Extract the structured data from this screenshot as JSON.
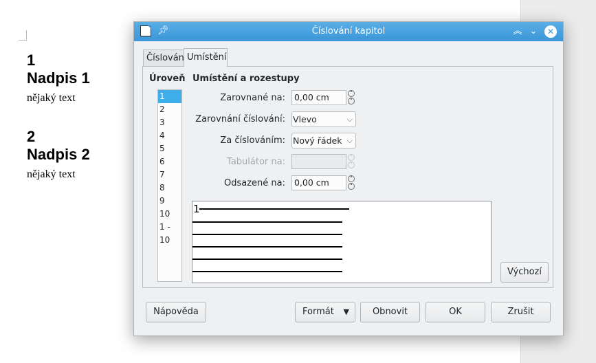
{
  "document": {
    "sections": [
      {
        "number": "1",
        "heading": "Nadpis 1",
        "text": "nějaký text"
      },
      {
        "number": "2",
        "heading": "Nadpis 2",
        "text": "nějaký text"
      }
    ]
  },
  "dialog": {
    "title": "Číslování kapitol",
    "window_buttons": {
      "shade": "︽",
      "minimize": "⌄",
      "close": "✕"
    },
    "tabs": [
      {
        "label": "Číslování",
        "active": false
      },
      {
        "label": "Umístění",
        "active": true
      }
    ],
    "level": {
      "heading": "Úroveň",
      "items": [
        "1",
        "2",
        "3",
        "4",
        "5",
        "6",
        "7",
        "8",
        "9",
        "10",
        "1 - 10"
      ],
      "selected": "1"
    },
    "position": {
      "heading": "Umístění a rozestupy",
      "aligned_at": {
        "label": "Zarovnané na:",
        "value": "0,00 cm"
      },
      "numbering_alignment": {
        "label": "Zarovnání číslování:",
        "value": "Vlevo"
      },
      "after_numbering": {
        "label": "Za číslováním:",
        "value": "Nový řádek"
      },
      "tab_stop_at": {
        "label": "Tabulátor na:",
        "value": "",
        "disabled": true
      },
      "indent_at": {
        "label": "Odsazené na:",
        "value": "0,00 cm"
      }
    },
    "preview": {
      "number": "1"
    },
    "buttons": {
      "default": "Výchozí",
      "help": "Nápověda",
      "format": "Formát",
      "reset": "Obnovit",
      "ok": "OK",
      "cancel": "Zrušit"
    },
    "colors": {
      "titlebar": "#3a96d8",
      "selection": "#3daee9",
      "dialog_bg": "#eff0f1"
    }
  }
}
